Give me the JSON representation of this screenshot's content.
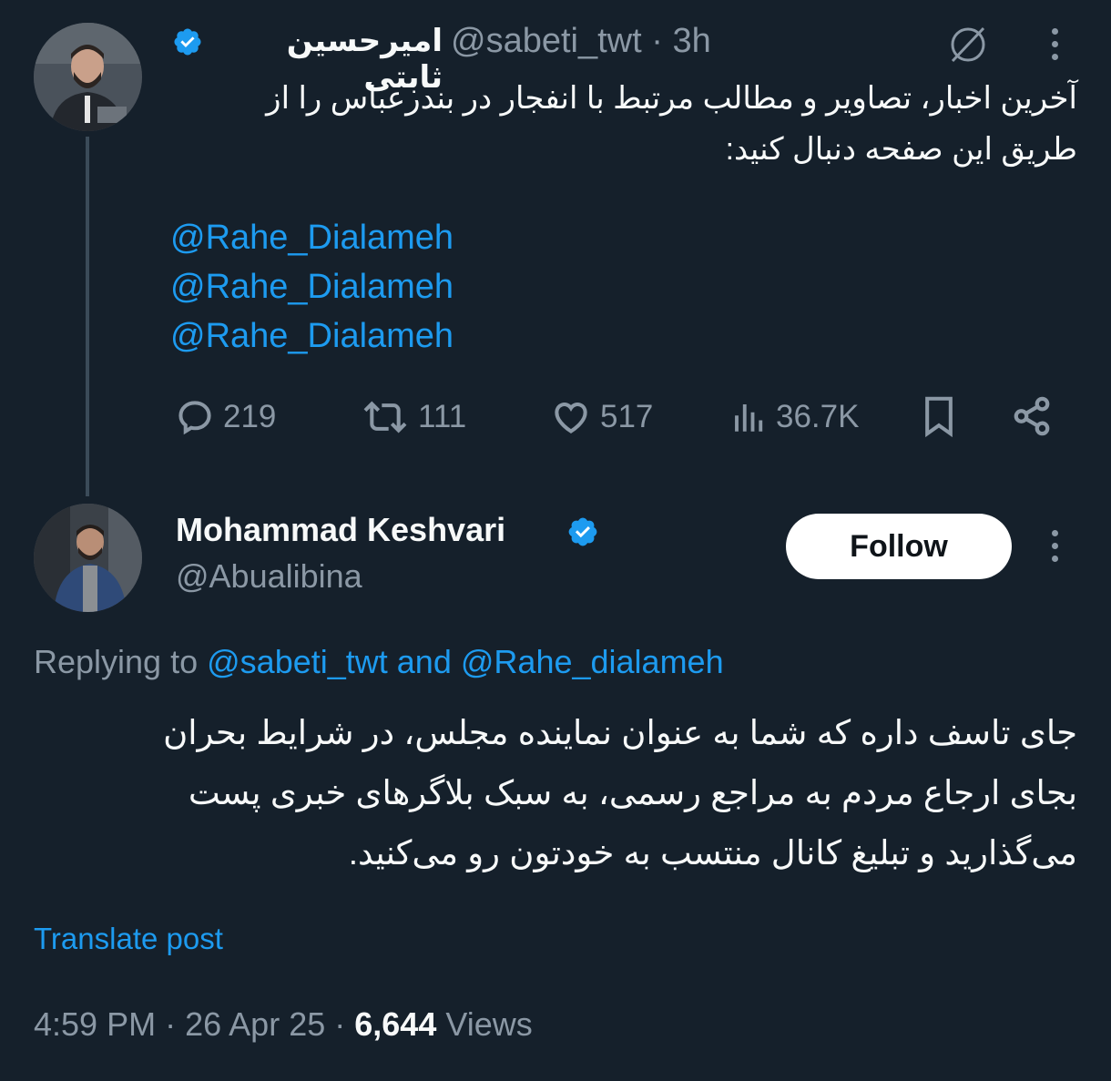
{
  "original_tweet": {
    "author_name": "امیرحسین ثابتی",
    "handle": "@sabeti_twt",
    "separator": "·",
    "time": "3h",
    "text_line1": "آخرین اخبار، تصاویر و مطالب مرتبط با انفجار در بندرعباس را از",
    "text_line2": "طریق این صفحه دنبال کنید:",
    "mentions": [
      "@Rahe_Dialameh",
      "@Rahe_Dialameh",
      "@Rahe_Dialameh"
    ],
    "actions": {
      "replies": "219",
      "reposts": "111",
      "likes": "517",
      "views": "36.7K"
    },
    "icons": {
      "grok": "grok-icon",
      "more": "more-icon",
      "reply": "reply-icon",
      "repost": "repost-icon",
      "like": "heart-icon",
      "views": "views-icon",
      "bookmark": "bookmark-icon",
      "share": "share-icon"
    }
  },
  "reply_tweet": {
    "author_name": "Mohammad Keshvari",
    "handle": "@Abualibina",
    "follow_label": "Follow",
    "replying_prefix": "Replying to",
    "replying_user1": "@sabeti_twt",
    "replying_and": "and",
    "replying_user2": "@Rahe_dialameh",
    "text_line1": "جای تاسف داره که شما به عنوان نماینده مجلس، در شرایط بحران",
    "text_line2": "بجای ارجاع مردم به مراجع رسمی، به سبک بلاگرهای خبری پست",
    "text_line3": "می‌گذارید و تبلیغ کانال منتسب به خودتون رو می‌کنید.",
    "translate_label": "Translate post",
    "timestamp": "4:59 PM",
    "date": "26 Apr 25",
    "dot": "·",
    "views_count": "6,644",
    "views_label": "Views"
  },
  "colors": {
    "background": "#15202b",
    "text": "#f7f9f9",
    "muted": "#8b98a5",
    "accent": "#1d9bf0",
    "thread_line": "#3b4b59"
  }
}
